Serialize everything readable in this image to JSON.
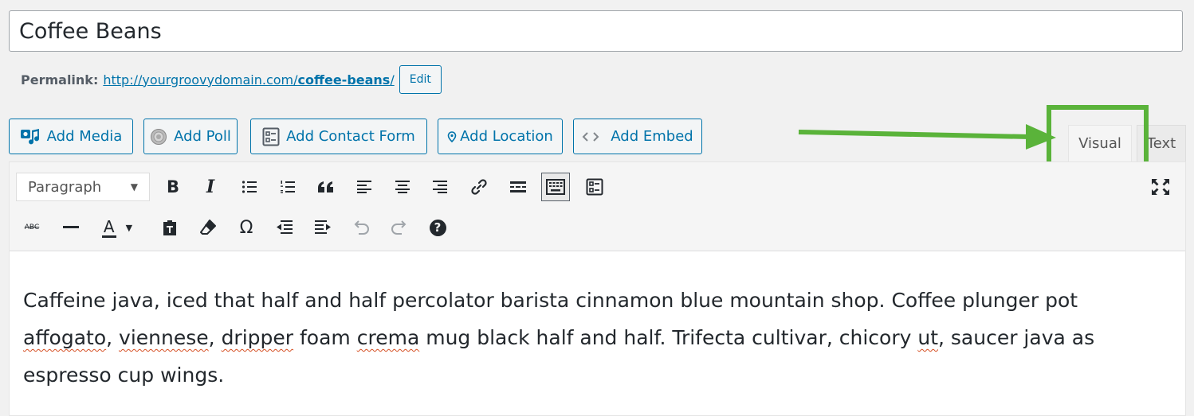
{
  "title": {
    "value": "Coffee Beans"
  },
  "permalink": {
    "label": "Permalink:",
    "url_prefix": "http://yourgroovydomain.com/",
    "slug": "coffee-beans",
    "url_suffix": "/",
    "edit_label": "Edit"
  },
  "media_buttons": [
    {
      "label": "Add Media",
      "icon": "media-icon"
    },
    {
      "label": "Add Poll",
      "icon": "poll-icon"
    },
    {
      "label": "Add Contact Form",
      "icon": "contact-form-icon"
    },
    {
      "label": "Add Location",
      "icon": "location-icon"
    },
    {
      "label": "Add Embed",
      "icon": "embed-icon"
    }
  ],
  "tabs": {
    "visual": "Visual",
    "text": "Text"
  },
  "toolbar": {
    "format_value": "Paragraph",
    "row1": [
      "bold-icon",
      "italic-icon",
      "bullet-list-icon",
      "numbered-list-icon",
      "blockquote-icon",
      "align-left-icon",
      "align-center-icon",
      "align-right-icon",
      "link-icon",
      "read-more-icon",
      "toolbar-toggle-icon",
      "form-icon",
      "fullscreen-icon"
    ],
    "row2": [
      "strikethrough-icon",
      "horizontal-line-icon",
      "text-color-icon",
      "paste-text-icon",
      "clear-formatting-icon",
      "special-character-icon",
      "outdent-icon",
      "indent-icon",
      "undo-icon",
      "redo-icon",
      "help-icon"
    ],
    "bold_glyph": "B",
    "italic_glyph": "I",
    "omega_glyph": "Ω",
    "strike_glyph": "ABC",
    "color_glyph": "A",
    "help_glyph": "?"
  },
  "content": {
    "s1": "Caffeine java, iced that half and half percolator barista cinnamon blue mountain shop. Coffee plunger pot ",
    "w1": "affogato",
    "s2": ", ",
    "w2": "viennese",
    "s3": ", ",
    "w3": "dripper",
    "s4": " foam ",
    "w4": "crema",
    "s5": " mug black half and half. Trifecta cultivar, chicory ",
    "w5": "ut",
    "s6": ", saucer java as espresso cup wings."
  },
  "colors": {
    "accent": "#0073aa",
    "highlight": "#5ab33a",
    "spellcheck": "#d54e21"
  }
}
